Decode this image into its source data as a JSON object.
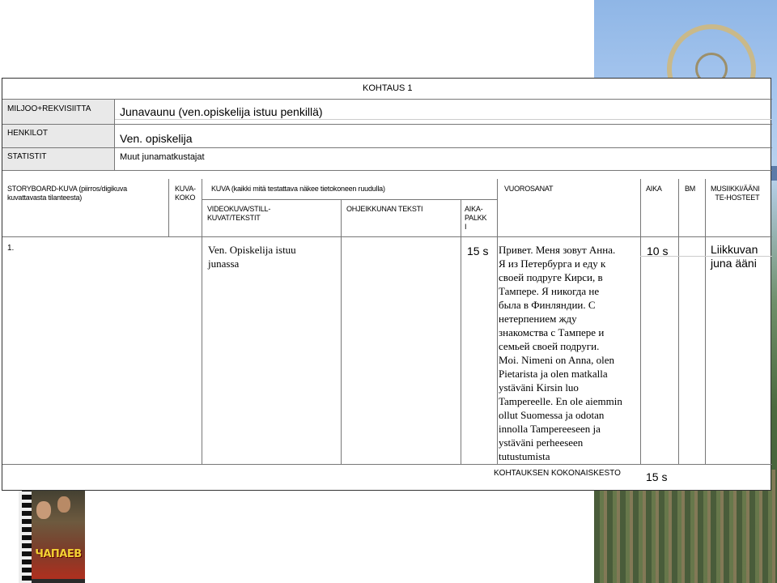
{
  "header": {
    "scene": "KOHTAUS 1",
    "labels": {
      "setting": "MILJOO+REKVISIITTA",
      "characters": "HENKILOT",
      "extras": "STATISTIT"
    },
    "values": {
      "setting": "Junavaunu (ven.opiskelija istuu penkillä)",
      "characters": "Ven. opiskelija",
      "extras": "Muut junamatkustajat"
    }
  },
  "columns": {
    "storyboard": "STORYBOARD-KUVA (piirros/digikuva kuvattavasta tilanteesta)",
    "shot_size": "KUVA-\nKOKO",
    "shot": "KUVA (kaikki mitä testattava näkee tietokoneen ruudulla)",
    "video": "VIDEOKUVA/STILL-\nKUVAT/TEKSTIT",
    "instructions": "OHJEIKKUNAN TEKSTI",
    "time_slot": "AIKA-\nPALKK\nI",
    "lines": "VUOROSANAT",
    "time": "AIKA",
    "bm": "BM",
    "sound": "MUSIIKKI/ÄÄNI\nTE-HOSTEET"
  },
  "row": {
    "number": "1.",
    "video": "Ven. Opiskelija istuu\njunassa",
    "time_slot": "15 s",
    "lines_ru": [
      "Привет. Меня зовут Анна.",
      "Я из Петербурга и еду к",
      "своей подруге Кирси, в",
      "Тампере. Я никогда не",
      "была в Финляндии. С",
      "нетерпением жду",
      "знакомства с Тампере и",
      "семьей своей подруги."
    ],
    "lines_fi": [
      "Moi. Nimeni on Anna, olen",
      "Pietarista ja olen matkalla",
      "ystäväni Kirsin luo",
      "Tampereelle. En ole aiemmin",
      "ollut Suomessa ja odotan",
      "innolla Tampereeseen ja",
      "ystäväni perheeseen",
      "tutustumista"
    ],
    "time": "10 s",
    "sound": "Liikkuvan\njuna ääni"
  },
  "footer": {
    "total_label": "KOHTAUKSEN KOKONAISKESTO",
    "total_value": "15 s"
  },
  "images": {
    "dvd_title": "ЧАПАЕВ"
  }
}
